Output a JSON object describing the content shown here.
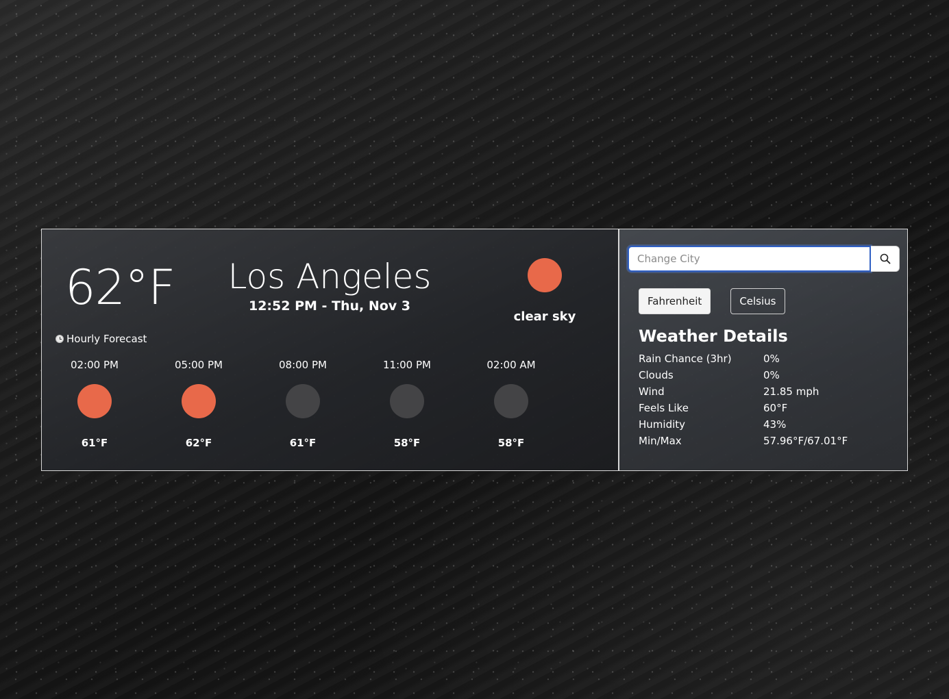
{
  "current": {
    "temperature": "62°F",
    "city": "Los Angeles",
    "datetime": "12:52 PM - Thu, Nov 3",
    "condition": "clear sky",
    "condition_icon_color": "#E8694A"
  },
  "hourly": {
    "heading": "Hourly Forecast",
    "items": [
      {
        "time": "02:00 PM",
        "temp": "61°F",
        "icon": "sun-icon",
        "color": "#E8694A"
      },
      {
        "time": "05:00 PM",
        "temp": "62°F",
        "icon": "sun-icon",
        "color": "#E8694A"
      },
      {
        "time": "08:00 PM",
        "temp": "61°F",
        "icon": "moon-icon",
        "color": "#444446"
      },
      {
        "time": "11:00 PM",
        "temp": "58°F",
        "icon": "moon-icon",
        "color": "#444446"
      },
      {
        "time": "02:00 AM",
        "temp": "58°F",
        "icon": "moon-icon",
        "color": "#444446"
      }
    ]
  },
  "search": {
    "placeholder": "Change City",
    "value": ""
  },
  "units": {
    "fahrenheit_label": "Fahrenheit",
    "celsius_label": "Celsius",
    "selected": "Fahrenheit"
  },
  "details": {
    "title": "Weather Details",
    "rows": [
      {
        "label": "Rain Chance (3hr)",
        "value": "0%"
      },
      {
        "label": "Clouds",
        "value": "0%"
      },
      {
        "label": "Wind",
        "value": "21.85 mph"
      },
      {
        "label": "Feels Like",
        "value": "60°F"
      },
      {
        "label": "Humidity",
        "value": "43%"
      },
      {
        "label": "Min/Max",
        "value": "57.96°F/67.01°F"
      }
    ]
  },
  "colors": {
    "sun": "#E8694A",
    "night": "#444446",
    "input_focus_border": "#2F5FC4"
  }
}
